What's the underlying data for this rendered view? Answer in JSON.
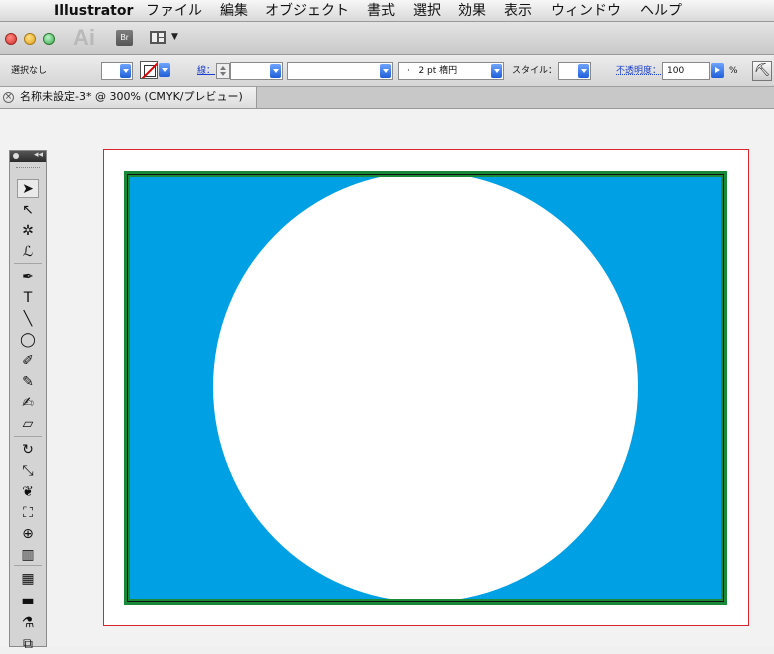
{
  "menubar": {
    "app_name": "Illustrator",
    "items": [
      "ファイル",
      "編集",
      "オブジェクト",
      "書式",
      "選択",
      "効果",
      "表示",
      "ウィンドウ",
      "ヘルプ"
    ]
  },
  "appbar": {
    "logo": "Ai",
    "bridge_label": "Br"
  },
  "controlbar": {
    "selection_label": "選択なし",
    "stroke_label": "線：",
    "stroke_profile": "2 pt 楕円",
    "style_label": "スタイル：",
    "opacity_label": "不透明度：",
    "opacity_value": "100",
    "opacity_unit": "%"
  },
  "document": {
    "tab_title": "名称未設定-3* @ 300% (CMYK/プレビュー)"
  },
  "artwork": {
    "frame_color": "#1a8a3a",
    "background_color": "#00a0e4",
    "circle_color": "#ffffff",
    "artboard_border_color": "#d9252e"
  },
  "toolbox": {
    "tools": [
      {
        "name": "selection-tool-icon",
        "glyph": "➤"
      },
      {
        "name": "direct-selection-tool-icon",
        "glyph": "↖"
      },
      {
        "name": "magic-wand-tool-icon",
        "glyph": "✲"
      },
      {
        "name": "lasso-tool-icon",
        "glyph": "ℒ"
      },
      {
        "name": "pen-tool-icon",
        "glyph": "✒"
      },
      {
        "name": "type-tool-icon",
        "glyph": "T"
      },
      {
        "name": "line-tool-icon",
        "glyph": "╲"
      },
      {
        "name": "ellipse-tool-icon",
        "glyph": "◯"
      },
      {
        "name": "paintbrush-tool-icon",
        "glyph": "✐"
      },
      {
        "name": "pencil-tool-icon",
        "glyph": "✎"
      },
      {
        "name": "blob-brush-tool-icon",
        "glyph": "✍"
      },
      {
        "name": "eraser-tool-icon",
        "glyph": "▱"
      },
      {
        "name": "rotate-tool-icon",
        "glyph": "↻"
      },
      {
        "name": "scale-tool-icon",
        "glyph": "⤡"
      },
      {
        "name": "warp-tool-icon",
        "glyph": "❦"
      },
      {
        "name": "free-transform-tool-icon",
        "glyph": "⛶"
      },
      {
        "name": "shape-builder-tool-icon",
        "glyph": "⊕"
      },
      {
        "name": "graph-tool-icon",
        "glyph": "▥"
      },
      {
        "name": "mesh-tool-icon",
        "glyph": "▦"
      },
      {
        "name": "gradient-tool-icon",
        "glyph": "▬"
      },
      {
        "name": "eyedropper-tool-icon",
        "glyph": "⚗"
      },
      {
        "name": "blend-tool-icon",
        "glyph": "⧉"
      }
    ]
  }
}
